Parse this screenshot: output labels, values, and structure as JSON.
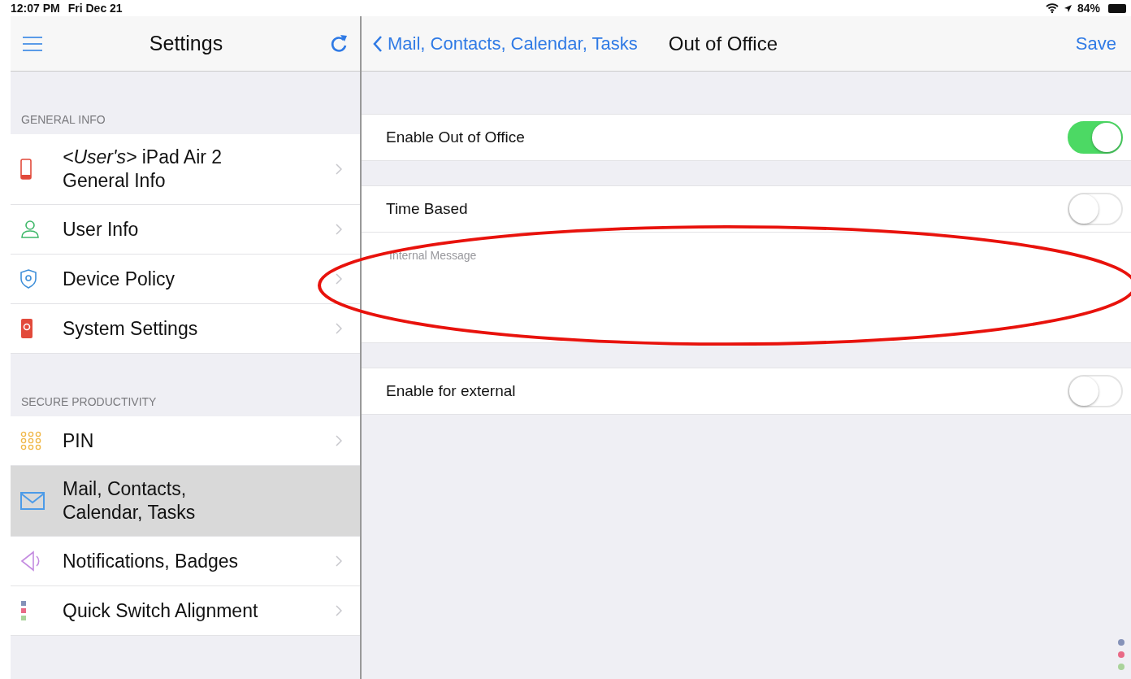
{
  "status_bar": {
    "time": "12:07 PM",
    "date": "Fri Dec 21",
    "battery": "84%"
  },
  "sidebar": {
    "title": "Settings",
    "sections": [
      {
        "header": "GENERAL INFO",
        "items": [
          {
            "kind": "phone",
            "label": "*<User's>*  iPad Air 2",
            "sublabel": "General Info",
            "selected": false,
            "chevron": true
          },
          {
            "kind": "person",
            "label": "User Info",
            "selected": false,
            "chevron": true
          },
          {
            "kind": "shield",
            "label": "Device Policy",
            "selected": false,
            "chevron": true
          },
          {
            "kind": "device-settings",
            "label": "System Settings",
            "selected": false,
            "chevron": true
          }
        ]
      },
      {
        "header": "SECURE PRODUCTIVITY",
        "items": [
          {
            "kind": "keypad",
            "label": "PIN",
            "selected": false,
            "chevron": true
          },
          {
            "kind": "mail",
            "label": "Mail, Contacts,",
            "sublabel": "Calendar, Tasks",
            "selected": true,
            "chevron": false
          },
          {
            "kind": "speaker",
            "label": "Notifications, Badges",
            "selected": false,
            "chevron": true
          },
          {
            "kind": "dots",
            "label": "Quick Switch Alignment",
            "selected": false,
            "chevron": true
          }
        ]
      }
    ]
  },
  "detail": {
    "back": "Mail, Contacts, Calendar, Tasks",
    "title": "Out of Office",
    "action": "Save",
    "groups": [
      [
        {
          "kind": "toggle",
          "label": "Enable Out of Office",
          "on": true
        }
      ],
      [
        {
          "kind": "toggle",
          "label": "Time Based",
          "on": false
        },
        {
          "kind": "textarea",
          "placeholder": "Internal Message"
        }
      ],
      [
        {
          "kind": "toggle",
          "label": "Enable for external",
          "on": false
        }
      ]
    ]
  }
}
